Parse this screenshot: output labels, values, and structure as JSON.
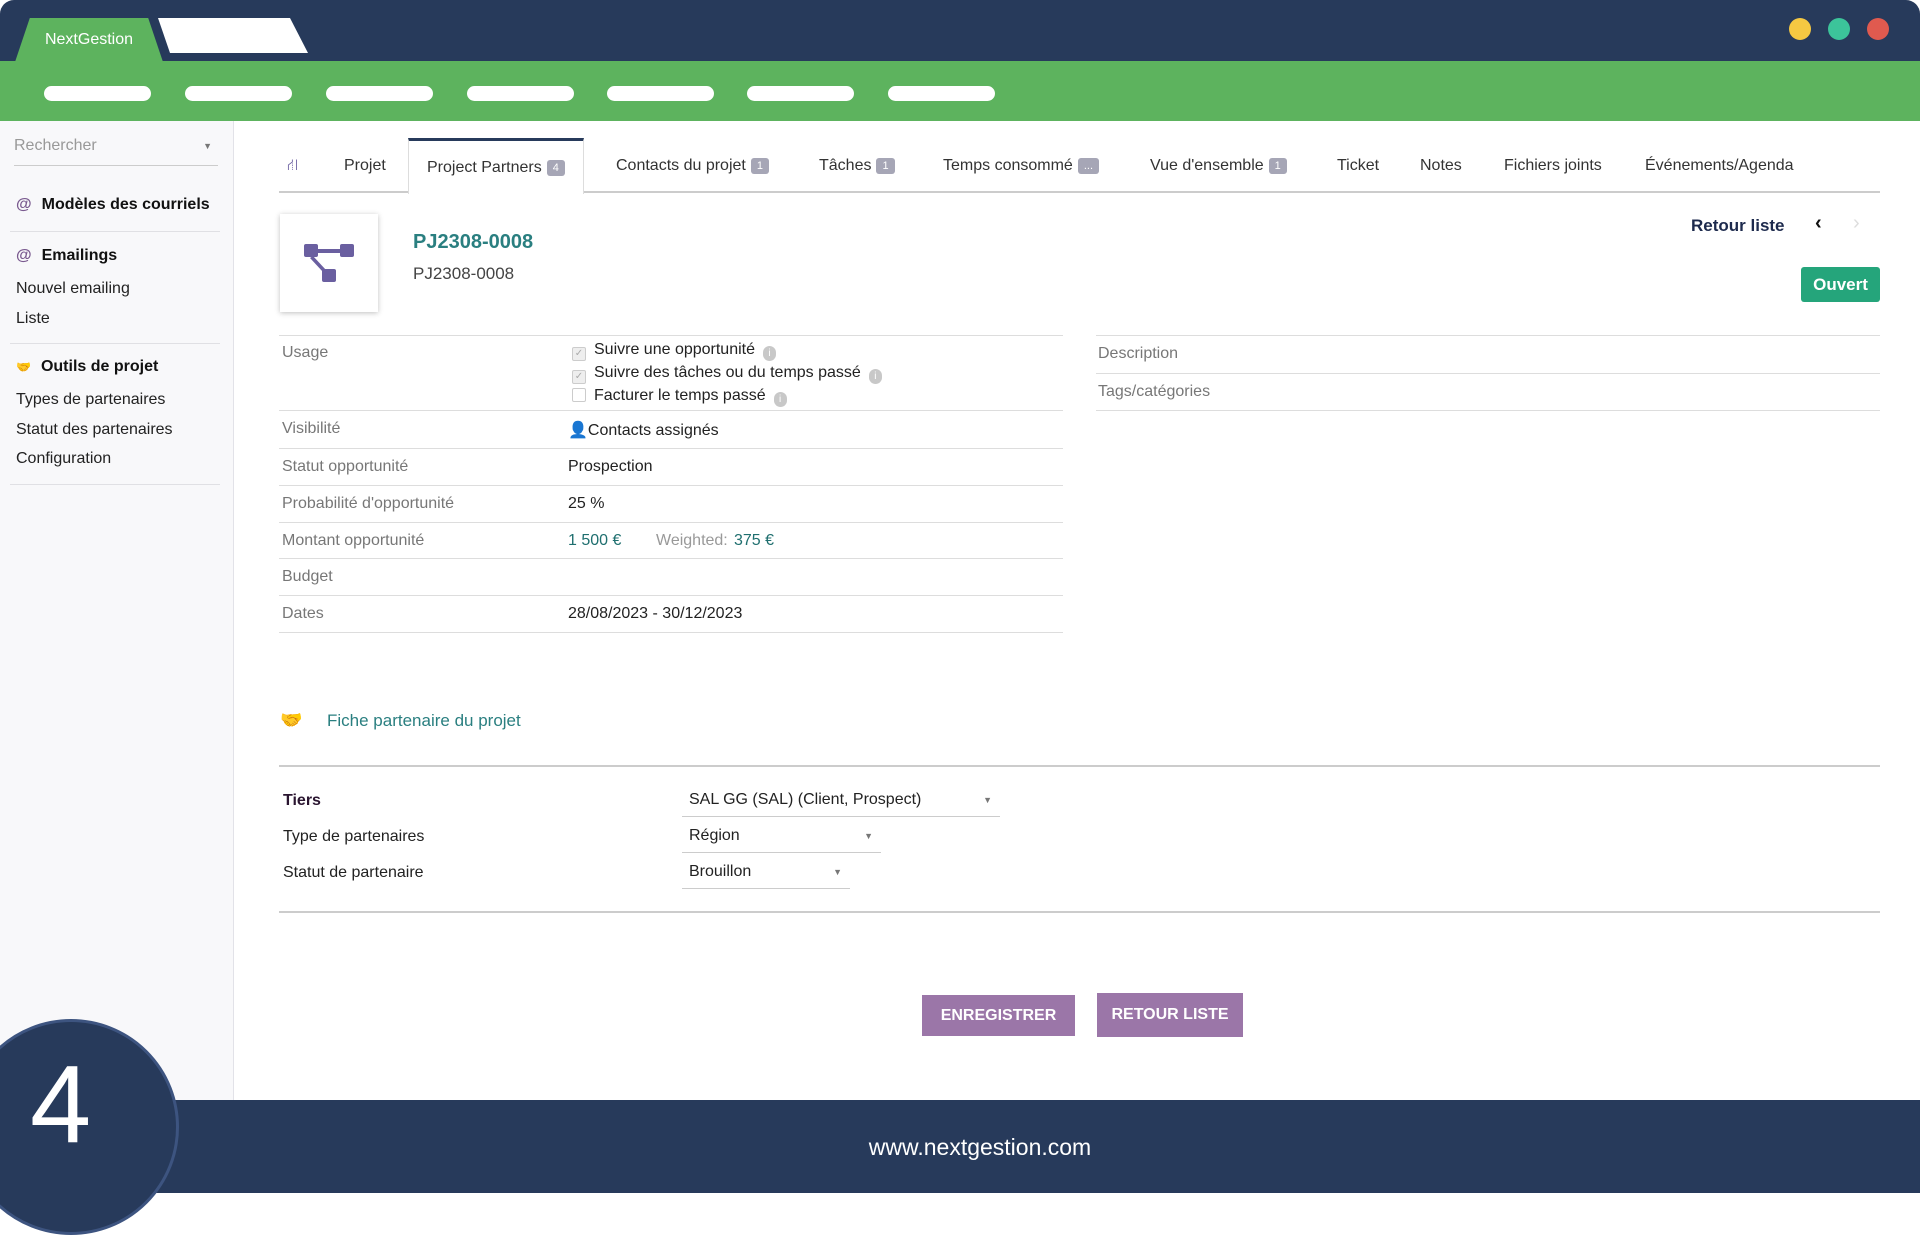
{
  "app": {
    "tab_label": "NextGestion",
    "window_dots": [
      "#f5c842",
      "#3cc49a",
      "#e05a4f"
    ]
  },
  "sidebar": {
    "search_placeholder": "Rechercher",
    "sections": [
      {
        "title": "Modèles des courriels",
        "icon": "at-icon",
        "items": []
      },
      {
        "title": "Emailings",
        "icon": "at-icon",
        "items": [
          "Nouvel emailing",
          "Liste"
        ]
      },
      {
        "title": "Outils de projet",
        "icon": "handshake-icon",
        "items": [
          "Types de partenaires",
          "Statut des partenaires",
          "Configuration"
        ]
      }
    ]
  },
  "tabs": [
    {
      "label": "Projet"
    },
    {
      "label": "Project Partners",
      "badge": "4"
    },
    {
      "label": "Contacts du projet",
      "badge": "1"
    },
    {
      "label": "Tâches",
      "badge": "1"
    },
    {
      "label": "Temps consommé",
      "badge": "..."
    },
    {
      "label": "Vue d'ensemble",
      "badge": "1"
    },
    {
      "label": "Ticket"
    },
    {
      "label": "Notes"
    },
    {
      "label": "Fichiers joints"
    },
    {
      "label": "Événements/Agenda"
    }
  ],
  "project": {
    "ref": "PJ2308-0008",
    "label": "PJ2308-0008",
    "back_link": "Retour liste",
    "status": "Ouvert"
  },
  "fields": {
    "usage_label": "Usage",
    "usage_options": [
      {
        "label": "Suivre une opportunité",
        "checked": true
      },
      {
        "label": "Suivre des tâches ou du temps passé",
        "checked": true
      },
      {
        "label": "Facturer le temps passé",
        "checked": false
      }
    ],
    "visibility_label": "Visibilité",
    "visibility": "Contacts assignés",
    "opp_status_label": "Statut opportunité",
    "opp_status": "Prospection",
    "prob_label": "Probabilité d'opportunité",
    "prob": "25 %",
    "amount_label": "Montant opportunité",
    "amount": "1 500 €",
    "weighted_label": "Weighted:",
    "weighted": "375 €",
    "budget_label": "Budget",
    "dates_label": "Dates",
    "dates": "28/08/2023 - 30/12/2023",
    "description_label": "Description",
    "tags_label": "Tags/catégories"
  },
  "partner": {
    "section_title": "Fiche partenaire du projet",
    "tiers_label": "Tiers",
    "tiers": "SAL GG (SAL) (Client, Prospect)",
    "type_label": "Type de partenaires",
    "type": "Région",
    "status_label": "Statut de partenaire",
    "status": "Brouillon"
  },
  "buttons": {
    "save": "ENREGISTRER",
    "back": "RETOUR LISTE"
  },
  "footer": {
    "url": "www.nextgestion.com",
    "step": "4"
  }
}
